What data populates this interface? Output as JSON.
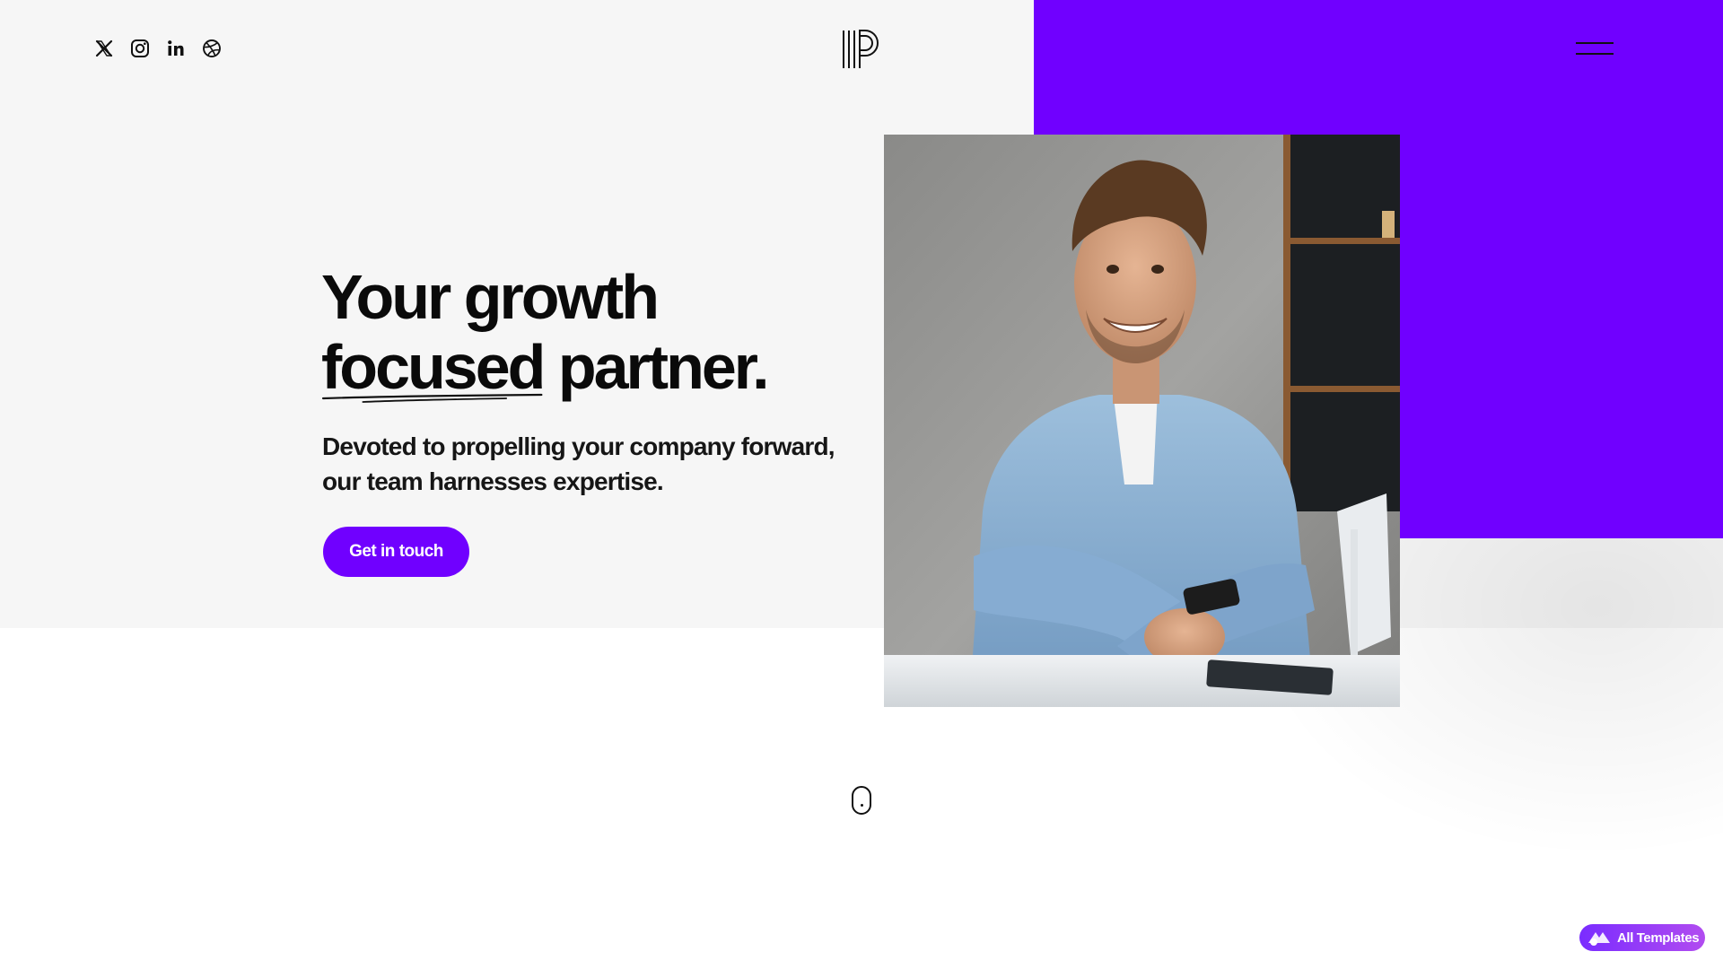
{
  "page": {
    "colors": {
      "accent": "#7000ff",
      "hero_background": "#f6f6f6",
      "page_background": "#ffffff",
      "text": "#0d0d0d"
    }
  },
  "header": {
    "social_icons": [
      "x-twitter-icon",
      "instagram-icon",
      "linkedin-icon",
      "dribbble-icon"
    ],
    "logo_icon": "striped-p-logo",
    "menu_icon": "hamburger-menu-icon"
  },
  "hero": {
    "headline_line1": "Your growth",
    "headline_underlined": "focused",
    "headline_rest": " partner.",
    "subhead_line1": "Devoted to propelling your company forward,",
    "subhead_line2": "our team harnesses expertise.",
    "cta_label": "Get in touch",
    "photo_description_icon": "portrait-photo"
  },
  "footer": {
    "scroll_icon": "mouse-scroll-icon",
    "templates_badge_label": "All Templates"
  }
}
